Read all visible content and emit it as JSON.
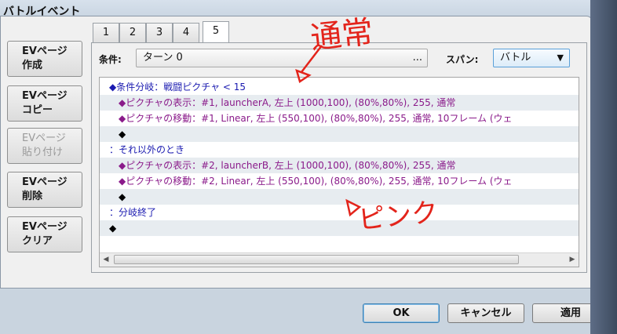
{
  "window": {
    "title": "バトルイベント"
  },
  "sidebar": {
    "buttons": [
      {
        "line1": "EVページ",
        "line2": "作成",
        "enabled": true
      },
      {
        "line1": "EVページ",
        "line2": "コピー",
        "enabled": true
      },
      {
        "line1": "EVページ",
        "line2": "貼り付け",
        "enabled": false
      },
      {
        "line1": "EVページ",
        "line2": "削除",
        "enabled": true
      },
      {
        "line1": "EVページ",
        "line2": "クリア",
        "enabled": true
      }
    ]
  },
  "tabs": [
    {
      "label": "1",
      "active": false
    },
    {
      "label": "2",
      "active": false
    },
    {
      "label": "3",
      "active": false
    },
    {
      "label": "4",
      "active": false
    },
    {
      "label": "5",
      "active": true
    }
  ],
  "condition": {
    "label": "条件:",
    "value": "ターン 0",
    "browse_glyph": "..."
  },
  "span": {
    "label": "スパン:",
    "value": "バトル"
  },
  "commands": [
    {
      "text": "◆条件分岐：戦闘ピクチャ < 15",
      "color": "#1a1ab0"
    },
    {
      "text": "◆ピクチャの表示：#1, launcherA, 左上 (1000,100), (80%,80%), 255, 通常",
      "color": "#8a1a8a"
    },
    {
      "text": "◆ピクチャの移動：#1, Linear, 左上 (550,100), (80%,80%), 255, 通常, 10フレーム (ウェ",
      "color": "#8a1a8a"
    },
    {
      "text": "◆",
      "color": "#000000"
    },
    {
      "text": "：それ以外のとき",
      "color": "#1a1ab0"
    },
    {
      "text": "◆ピクチャの表示：#2, launcherB, 左上 (1000,100), (80%,80%), 255, 通常",
      "color": "#8a1a8a"
    },
    {
      "text": "◆ピクチャの移動：#2, Linear, 左上 (550,100), (80%,80%), 255, 通常, 10フレーム (ウェ",
      "color": "#8a1a8a"
    },
    {
      "text": "◆",
      "color": "#000000"
    },
    {
      "text": "：分岐終了",
      "color": "#1a1ab0"
    },
    {
      "text": "◆",
      "color": "#000000"
    }
  ],
  "annotations": {
    "top": "通常",
    "bottom": "ピンク"
  },
  "dialog_buttons": {
    "ok": "OK",
    "cancel": "キャンセル",
    "apply": "適用"
  }
}
